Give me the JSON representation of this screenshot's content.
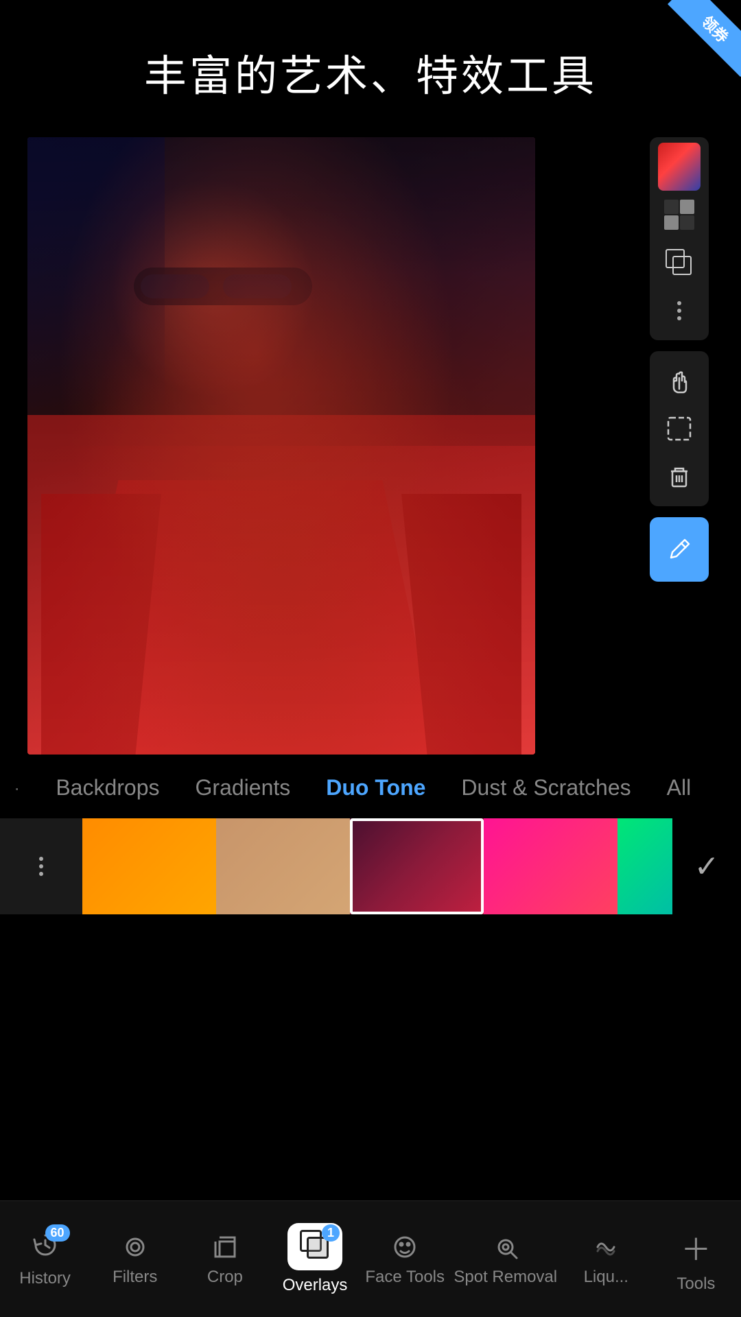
{
  "app": {
    "title": "丰富的艺术、特效工具",
    "corner_badge": "领券"
  },
  "editor": {
    "image_alt": "Woman with sunglasses red duo-tone photo"
  },
  "right_toolbar": {
    "color_swatch_label": "color-swatch",
    "checker_label": "transparency",
    "duplicate_label": "duplicate",
    "more_label": "more options",
    "hand_label": "pan",
    "select_label": "select",
    "delete_label": "delete",
    "eyedropper_label": "eyedropper"
  },
  "categories": [
    {
      "id": "backdrops",
      "label": "Backdrops",
      "active": false
    },
    {
      "id": "gradients",
      "label": "Gradients",
      "active": false
    },
    {
      "id": "duo-tone",
      "label": "Duo Tone",
      "active": true
    },
    {
      "id": "dust-scratches",
      "label": "Dust & Scratches",
      "active": false
    },
    {
      "id": "all",
      "label": "All",
      "active": false
    }
  ],
  "swatches": [
    {
      "id": "more",
      "type": "more"
    },
    {
      "id": "orange",
      "type": "orange",
      "selected": false
    },
    {
      "id": "tan",
      "type": "tan",
      "selected": false
    },
    {
      "id": "crimson",
      "type": "crimson",
      "selected": true
    },
    {
      "id": "hot-pink",
      "type": "hot",
      "selected": false
    },
    {
      "id": "green-partial",
      "type": "partial",
      "selected": false
    }
  ],
  "bottom_nav": {
    "items": [
      {
        "id": "history",
        "label": "History",
        "badge": "60",
        "active": false
      },
      {
        "id": "filters",
        "label": "Filters",
        "badge": null,
        "active": false
      },
      {
        "id": "crop",
        "label": "Crop",
        "badge": null,
        "active": false
      },
      {
        "id": "overlays",
        "label": "Overlays",
        "badge": "1",
        "active": true
      },
      {
        "id": "face-tools",
        "label": "Face Tools",
        "badge": null,
        "active": false
      },
      {
        "id": "spot-removal",
        "label": "Spot Removal",
        "badge": null,
        "active": false
      },
      {
        "id": "liquify",
        "label": "Liqu...",
        "badge": null,
        "active": false
      },
      {
        "id": "tools",
        "label": "Tools",
        "badge": null,
        "active": false
      }
    ]
  }
}
